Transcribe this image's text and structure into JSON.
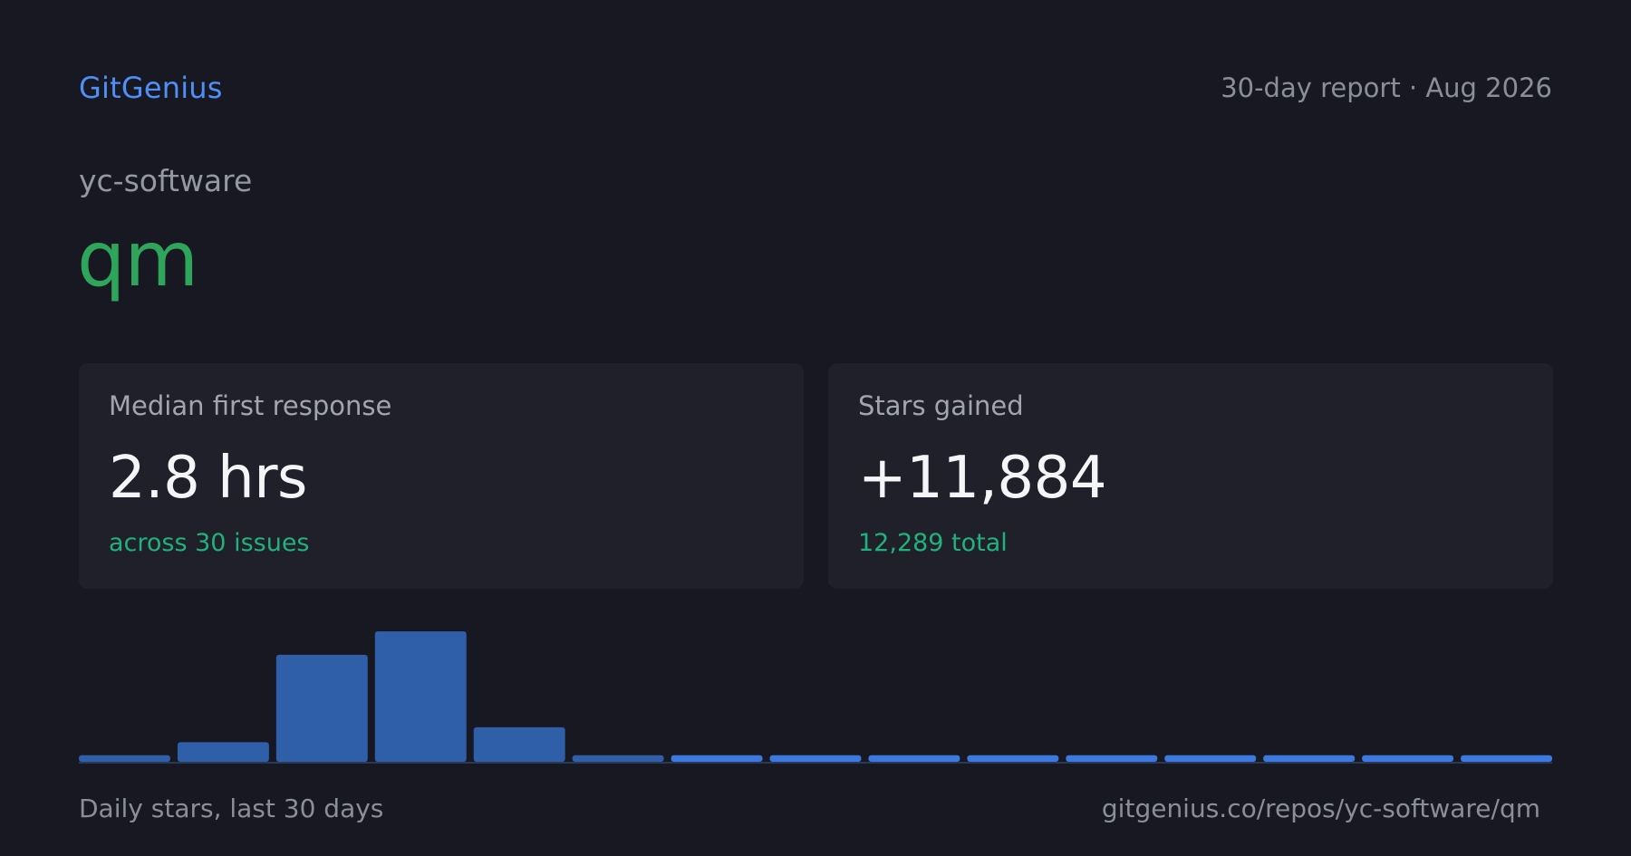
{
  "header": {
    "brand": "GitGenius",
    "report_label": "30-day report · Aug 2026"
  },
  "repo": {
    "owner": "yc-software",
    "name": "qm"
  },
  "stats": {
    "median_response": {
      "label": "Median first response",
      "value": "2.8 hrs",
      "sub": "across 30 issues"
    },
    "stars": {
      "label": "Stars gained",
      "value": "+11,884",
      "sub": "12,289 total"
    }
  },
  "footer": {
    "caption": "Daily stars, last 30 days",
    "url": "gitgenius.co/repos/yc-software/qm"
  },
  "colors": {
    "background": "#171821",
    "card": "#1f2029",
    "brand": "#4f8ff7",
    "repo_name": "#2ea55b",
    "positive": "#21b27c",
    "bar_past": "#2f5fa8",
    "bar_recent": "#3b79e0",
    "baseline": "#2a3a56"
  },
  "chart_data": {
    "type": "bar",
    "values": [
      100,
      300,
      1640,
      2000,
      530,
      100,
      100,
      100,
      100,
      100,
      100,
      100,
      100,
      100,
      100
    ],
    "ylim": [
      0,
      2000
    ],
    "xlabel": "",
    "ylabel": "",
    "title": "",
    "grid": false,
    "legend": "none"
  }
}
